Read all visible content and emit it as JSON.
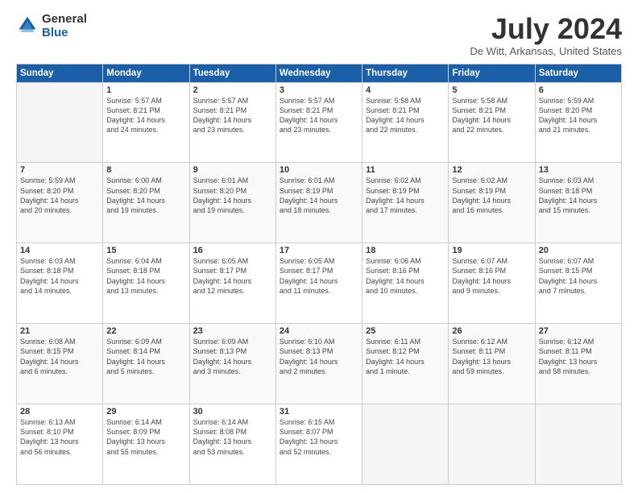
{
  "logo": {
    "general": "General",
    "blue": "Blue"
  },
  "title": "July 2024",
  "subtitle": "De Witt, Arkansas, United States",
  "days_header": [
    "Sunday",
    "Monday",
    "Tuesday",
    "Wednesday",
    "Thursday",
    "Friday",
    "Saturday"
  ],
  "weeks": [
    [
      {
        "num": "",
        "info": ""
      },
      {
        "num": "1",
        "info": "Sunrise: 5:57 AM\nSunset: 8:21 PM\nDaylight: 14 hours\nand 24 minutes."
      },
      {
        "num": "2",
        "info": "Sunrise: 5:57 AM\nSunset: 8:21 PM\nDaylight: 14 hours\nand 23 minutes."
      },
      {
        "num": "3",
        "info": "Sunrise: 5:57 AM\nSunset: 8:21 PM\nDaylight: 14 hours\nand 23 minutes."
      },
      {
        "num": "4",
        "info": "Sunrise: 5:58 AM\nSunset: 8:21 PM\nDaylight: 14 hours\nand 22 minutes."
      },
      {
        "num": "5",
        "info": "Sunrise: 5:58 AM\nSunset: 8:21 PM\nDaylight: 14 hours\nand 22 minutes."
      },
      {
        "num": "6",
        "info": "Sunrise: 5:59 AM\nSunset: 8:20 PM\nDaylight: 14 hours\nand 21 minutes."
      }
    ],
    [
      {
        "num": "7",
        "info": "Sunrise: 5:59 AM\nSunset: 8:20 PM\nDaylight: 14 hours\nand 20 minutes."
      },
      {
        "num": "8",
        "info": "Sunrise: 6:00 AM\nSunset: 8:20 PM\nDaylight: 14 hours\nand 19 minutes."
      },
      {
        "num": "9",
        "info": "Sunrise: 6:01 AM\nSunset: 8:20 PM\nDaylight: 14 hours\nand 19 minutes."
      },
      {
        "num": "10",
        "info": "Sunrise: 6:01 AM\nSunset: 8:19 PM\nDaylight: 14 hours\nand 18 minutes."
      },
      {
        "num": "11",
        "info": "Sunrise: 6:02 AM\nSunset: 8:19 PM\nDaylight: 14 hours\nand 17 minutes."
      },
      {
        "num": "12",
        "info": "Sunrise: 6:02 AM\nSunset: 8:19 PM\nDaylight: 14 hours\nand 16 minutes."
      },
      {
        "num": "13",
        "info": "Sunrise: 6:03 AM\nSunset: 8:18 PM\nDaylight: 14 hours\nand 15 minutes."
      }
    ],
    [
      {
        "num": "14",
        "info": "Sunrise: 6:03 AM\nSunset: 8:18 PM\nDaylight: 14 hours\nand 14 minutes."
      },
      {
        "num": "15",
        "info": "Sunrise: 6:04 AM\nSunset: 8:18 PM\nDaylight: 14 hours\nand 13 minutes."
      },
      {
        "num": "16",
        "info": "Sunrise: 6:05 AM\nSunset: 8:17 PM\nDaylight: 14 hours\nand 12 minutes."
      },
      {
        "num": "17",
        "info": "Sunrise: 6:05 AM\nSunset: 8:17 PM\nDaylight: 14 hours\nand 11 minutes."
      },
      {
        "num": "18",
        "info": "Sunrise: 6:06 AM\nSunset: 8:16 PM\nDaylight: 14 hours\nand 10 minutes."
      },
      {
        "num": "19",
        "info": "Sunrise: 6:07 AM\nSunset: 8:16 PM\nDaylight: 14 hours\nand 9 minutes."
      },
      {
        "num": "20",
        "info": "Sunrise: 6:07 AM\nSunset: 8:15 PM\nDaylight: 14 hours\nand 7 minutes."
      }
    ],
    [
      {
        "num": "21",
        "info": "Sunrise: 6:08 AM\nSunset: 8:15 PM\nDaylight: 14 hours\nand 6 minutes."
      },
      {
        "num": "22",
        "info": "Sunrise: 6:09 AM\nSunset: 8:14 PM\nDaylight: 14 hours\nand 5 minutes."
      },
      {
        "num": "23",
        "info": "Sunrise: 6:09 AM\nSunset: 8:13 PM\nDaylight: 14 hours\nand 3 minutes."
      },
      {
        "num": "24",
        "info": "Sunrise: 6:10 AM\nSunset: 8:13 PM\nDaylight: 14 hours\nand 2 minutes."
      },
      {
        "num": "25",
        "info": "Sunrise: 6:11 AM\nSunset: 8:12 PM\nDaylight: 14 hours\nand 1 minute."
      },
      {
        "num": "26",
        "info": "Sunrise: 6:12 AM\nSunset: 8:11 PM\nDaylight: 13 hours\nand 59 minutes."
      },
      {
        "num": "27",
        "info": "Sunrise: 6:12 AM\nSunset: 8:11 PM\nDaylight: 13 hours\nand 58 minutes."
      }
    ],
    [
      {
        "num": "28",
        "info": "Sunrise: 6:13 AM\nSunset: 8:10 PM\nDaylight: 13 hours\nand 56 minutes."
      },
      {
        "num": "29",
        "info": "Sunrise: 6:14 AM\nSunset: 8:09 PM\nDaylight: 13 hours\nand 55 minutes."
      },
      {
        "num": "30",
        "info": "Sunrise: 6:14 AM\nSunset: 8:08 PM\nDaylight: 13 hours\nand 53 minutes."
      },
      {
        "num": "31",
        "info": "Sunrise: 6:15 AM\nSunset: 8:07 PM\nDaylight: 13 hours\nand 52 minutes."
      },
      {
        "num": "",
        "info": ""
      },
      {
        "num": "",
        "info": ""
      },
      {
        "num": "",
        "info": ""
      }
    ]
  ]
}
